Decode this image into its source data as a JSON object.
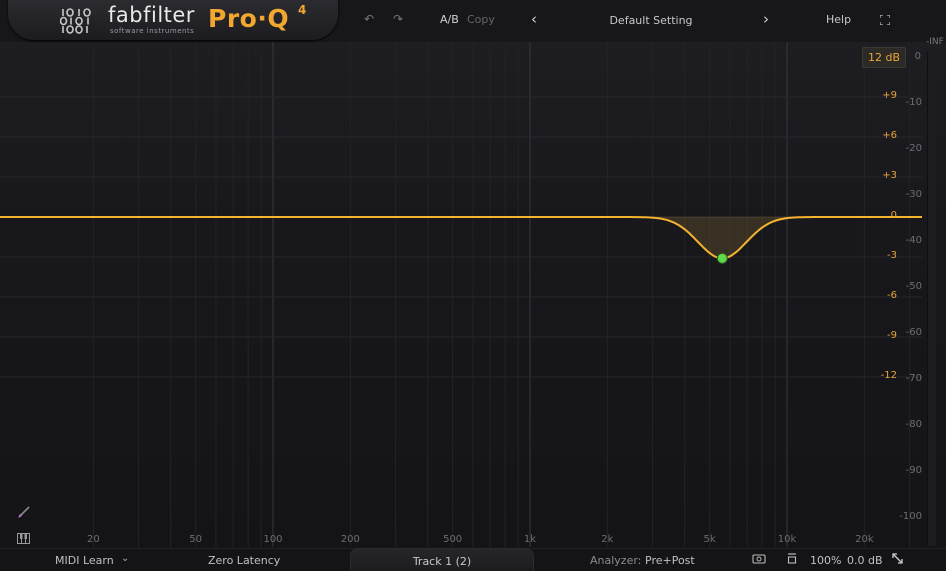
{
  "header": {
    "brand": "fabfilter",
    "brand_sub": "software instruments",
    "product": "Pro·Q",
    "product_version": "4",
    "ab_label": "A/B",
    "copy_label": "Copy",
    "preset_name": "Default Setting",
    "help_label": "Help",
    "icons": [
      "undo-icon",
      "redo-icon",
      "chevron-left-icon",
      "chevron-right-icon",
      "fullscreen-icon"
    ]
  },
  "graph": {
    "range_label": "12 dB",
    "db_scale": [
      "+9",
      "+6",
      "+3",
      "0",
      "-3",
      "-6",
      "-9",
      "-12"
    ],
    "analyzer_scale": [
      "0",
      "-10",
      "-20",
      "-30",
      "-40",
      "-50",
      "-60",
      "-70",
      "-80",
      "-90",
      "-100"
    ],
    "freq_labels": [
      "20",
      "50",
      "100",
      "200",
      "500",
      "1k",
      "2k",
      "5k",
      "10k",
      "20k"
    ],
    "meter_label": "-INF",
    "curve_color": "#f5b32e",
    "band": {
      "frequency": "5.6k",
      "gain_db": -3.1,
      "color": "#5fd84a"
    }
  },
  "footer": {
    "midi_learn": "MIDI Learn",
    "latency_mode": "Zero Latency",
    "track_name": "Track 1 (2)",
    "analyzer_label": "Analyzer:",
    "analyzer_value": "Pre+Post",
    "zoom": "100%",
    "output_gain": "0.0 dB"
  }
}
